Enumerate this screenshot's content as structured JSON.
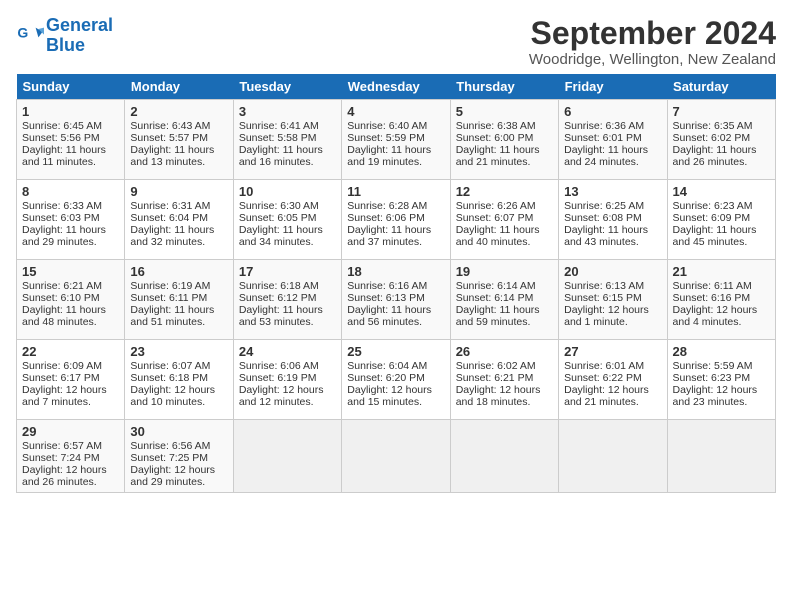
{
  "header": {
    "logo_line1": "General",
    "logo_line2": "Blue",
    "title": "September 2024",
    "subtitle": "Woodridge, Wellington, New Zealand"
  },
  "days_of_week": [
    "Sunday",
    "Monday",
    "Tuesday",
    "Wednesday",
    "Thursday",
    "Friday",
    "Saturday"
  ],
  "weeks": [
    [
      {
        "day": "1",
        "sunrise": "6:45 AM",
        "sunset": "5:56 PM",
        "daylight": "11 hours and 11 minutes."
      },
      {
        "day": "2",
        "sunrise": "6:43 AM",
        "sunset": "5:57 PM",
        "daylight": "11 hours and 13 minutes."
      },
      {
        "day": "3",
        "sunrise": "6:41 AM",
        "sunset": "5:58 PM",
        "daylight": "11 hours and 16 minutes."
      },
      {
        "day": "4",
        "sunrise": "6:40 AM",
        "sunset": "5:59 PM",
        "daylight": "11 hours and 19 minutes."
      },
      {
        "day": "5",
        "sunrise": "6:38 AM",
        "sunset": "6:00 PM",
        "daylight": "11 hours and 21 minutes."
      },
      {
        "day": "6",
        "sunrise": "6:36 AM",
        "sunset": "6:01 PM",
        "daylight": "11 hours and 24 minutes."
      },
      {
        "day": "7",
        "sunrise": "6:35 AM",
        "sunset": "6:02 PM",
        "daylight": "11 hours and 26 minutes."
      }
    ],
    [
      {
        "day": "8",
        "sunrise": "6:33 AM",
        "sunset": "6:03 PM",
        "daylight": "11 hours and 29 minutes."
      },
      {
        "day": "9",
        "sunrise": "6:31 AM",
        "sunset": "6:04 PM",
        "daylight": "11 hours and 32 minutes."
      },
      {
        "day": "10",
        "sunrise": "6:30 AM",
        "sunset": "6:05 PM",
        "daylight": "11 hours and 34 minutes."
      },
      {
        "day": "11",
        "sunrise": "6:28 AM",
        "sunset": "6:06 PM",
        "daylight": "11 hours and 37 minutes."
      },
      {
        "day": "12",
        "sunrise": "6:26 AM",
        "sunset": "6:07 PM",
        "daylight": "11 hours and 40 minutes."
      },
      {
        "day": "13",
        "sunrise": "6:25 AM",
        "sunset": "6:08 PM",
        "daylight": "11 hours and 43 minutes."
      },
      {
        "day": "14",
        "sunrise": "6:23 AM",
        "sunset": "6:09 PM",
        "daylight": "11 hours and 45 minutes."
      }
    ],
    [
      {
        "day": "15",
        "sunrise": "6:21 AM",
        "sunset": "6:10 PM",
        "daylight": "11 hours and 48 minutes."
      },
      {
        "day": "16",
        "sunrise": "6:19 AM",
        "sunset": "6:11 PM",
        "daylight": "11 hours and 51 minutes."
      },
      {
        "day": "17",
        "sunrise": "6:18 AM",
        "sunset": "6:12 PM",
        "daylight": "11 hours and 53 minutes."
      },
      {
        "day": "18",
        "sunrise": "6:16 AM",
        "sunset": "6:13 PM",
        "daylight": "11 hours and 56 minutes."
      },
      {
        "day": "19",
        "sunrise": "6:14 AM",
        "sunset": "6:14 PM",
        "daylight": "11 hours and 59 minutes."
      },
      {
        "day": "20",
        "sunrise": "6:13 AM",
        "sunset": "6:15 PM",
        "daylight": "12 hours and 1 minute."
      },
      {
        "day": "21",
        "sunrise": "6:11 AM",
        "sunset": "6:16 PM",
        "daylight": "12 hours and 4 minutes."
      }
    ],
    [
      {
        "day": "22",
        "sunrise": "6:09 AM",
        "sunset": "6:17 PM",
        "daylight": "12 hours and 7 minutes."
      },
      {
        "day": "23",
        "sunrise": "6:07 AM",
        "sunset": "6:18 PM",
        "daylight": "12 hours and 10 minutes."
      },
      {
        "day": "24",
        "sunrise": "6:06 AM",
        "sunset": "6:19 PM",
        "daylight": "12 hours and 12 minutes."
      },
      {
        "day": "25",
        "sunrise": "6:04 AM",
        "sunset": "6:20 PM",
        "daylight": "12 hours and 15 minutes."
      },
      {
        "day": "26",
        "sunrise": "6:02 AM",
        "sunset": "6:21 PM",
        "daylight": "12 hours and 18 minutes."
      },
      {
        "day": "27",
        "sunrise": "6:01 AM",
        "sunset": "6:22 PM",
        "daylight": "12 hours and 21 minutes."
      },
      {
        "day": "28",
        "sunrise": "5:59 AM",
        "sunset": "6:23 PM",
        "daylight": "12 hours and 23 minutes."
      }
    ],
    [
      {
        "day": "29",
        "sunrise": "6:57 AM",
        "sunset": "7:24 PM",
        "daylight": "12 hours and 26 minutes."
      },
      {
        "day": "30",
        "sunrise": "6:56 AM",
        "sunset": "7:25 PM",
        "daylight": "12 hours and 29 minutes."
      },
      null,
      null,
      null,
      null,
      null
    ]
  ]
}
